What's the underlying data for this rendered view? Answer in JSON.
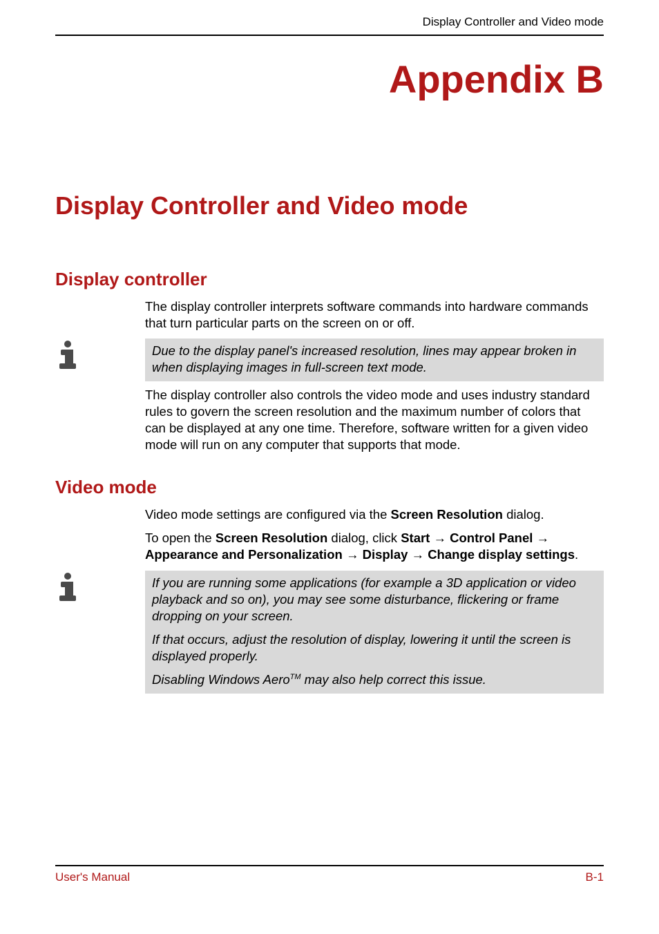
{
  "header": {
    "running_head": "Display Controller and Video mode"
  },
  "appendix_label": "Appendix B",
  "title": "Display Controller and Video mode",
  "sections": {
    "display_controller": {
      "heading": "Display controller",
      "p1": "The display controller interprets software commands into hardware commands that turn particular parts on the screen on or off.",
      "note": "Due to the display panel's increased resolution, lines may appear broken in when displaying images in full-screen text mode.",
      "p2": "The display controller also controls the video mode and uses industry standard rules to govern the screen resolution and the maximum number of colors that can be displayed at any one time. Therefore, software written for a given video mode will run on any computer that supports that mode."
    },
    "video_mode": {
      "heading": "Video mode",
      "p1_pre": "Video mode settings are configured via the ",
      "p1_b1": "Screen Resolution",
      "p1_post": " dialog.",
      "p2_pre": "To open the ",
      "p2_b1": "Screen Resolution",
      "p2_mid1": " dialog, click ",
      "p2_b2": "Start",
      "p2_b3": "Control Panel",
      "p2_b4": "Appearance and Personalization",
      "p2_b5": "Display",
      "p2_b6": "Change display settings",
      "p2_end": ".",
      "note_p1": "If you are running some applications (for example a 3D application or video playback and so on), you may see some disturbance, flickering or frame dropping on your screen.",
      "note_p2": "If that occurs, adjust the resolution of display, lowering it until the screen is displayed properly.",
      "note_p3_pre": "Disabling Windows Aero",
      "note_p3_tm": "TM",
      "note_p3_post": " may also help correct this issue."
    }
  },
  "arrow": "→",
  "footer": {
    "left": "User's Manual",
    "right": "B-1"
  },
  "icons": {
    "info": "info-icon"
  }
}
